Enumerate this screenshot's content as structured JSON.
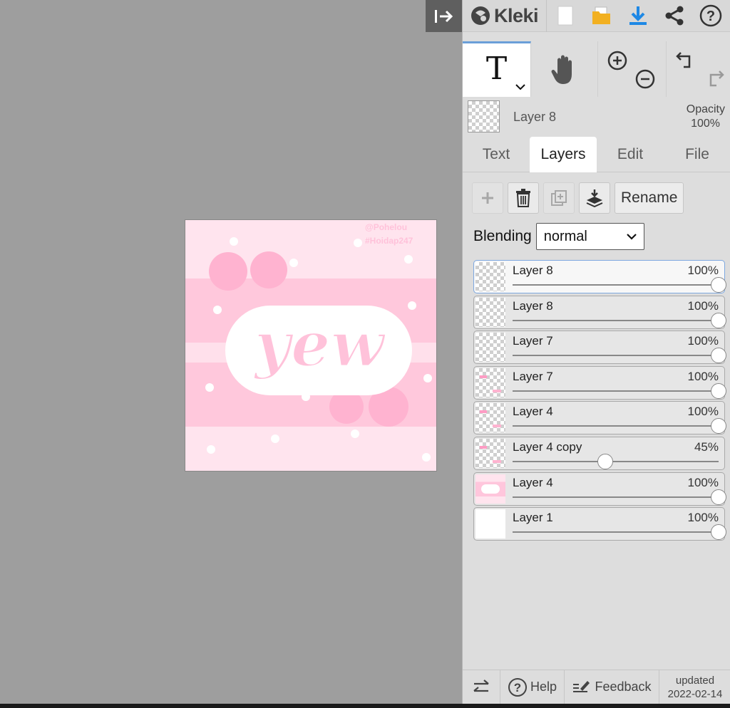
{
  "app": {
    "name": "Kleki"
  },
  "colors": {
    "accent": "#1e88e5",
    "open_folder": "#f2b021",
    "canvas_pink": "#ffc6dc",
    "canvas_light": "#ffe4ee"
  },
  "toolbar": {
    "icons": [
      "new-image-icon",
      "open-icon",
      "download-icon",
      "share-icon",
      "help-icon"
    ]
  },
  "tools": {
    "text_tool_glyph": "T",
    "icons": [
      "text-tool-icon",
      "hand-tool-icon",
      "zoom-in-icon",
      "zoom-out-icon",
      "undo-icon",
      "redo-icon"
    ]
  },
  "current_layer": {
    "name": "Layer 8",
    "opacity_label": "Opacity",
    "opacity_value": "100%"
  },
  "tabs": [
    "Text",
    "Layers",
    "Edit",
    "File"
  ],
  "active_tab": "Layers",
  "layer_actions": {
    "rename_label": "Rename"
  },
  "blending": {
    "label": "Blending",
    "value": "normal"
  },
  "layers": [
    {
      "name": "Layer 8",
      "opacity": "100%",
      "level": 1.0,
      "selected": true
    },
    {
      "name": "Layer 8",
      "opacity": "100%",
      "level": 1.0,
      "selected": false
    },
    {
      "name": "Layer 7",
      "opacity": "100%",
      "level": 1.0,
      "selected": false
    },
    {
      "name": "Layer 7",
      "opacity": "100%",
      "level": 1.0,
      "selected": false
    },
    {
      "name": "Layer 4",
      "opacity": "100%",
      "level": 1.0,
      "selected": false
    },
    {
      "name": "Layer 4 copy",
      "opacity": "45%",
      "level": 0.45,
      "selected": false
    },
    {
      "name": "Layer 4",
      "opacity": "100%",
      "level": 1.0,
      "selected": false
    },
    {
      "name": "Layer 1",
      "opacity": "100%",
      "level": 1.0,
      "selected": false
    }
  ],
  "canvas_art": {
    "word": "yew",
    "watermark_line1": "@Pohelou",
    "watermark_line2": "#Hoidap247"
  },
  "footer": {
    "help": "Help",
    "feedback": "Feedback",
    "updated_label": "updated",
    "updated_date": "2022-02-14"
  }
}
